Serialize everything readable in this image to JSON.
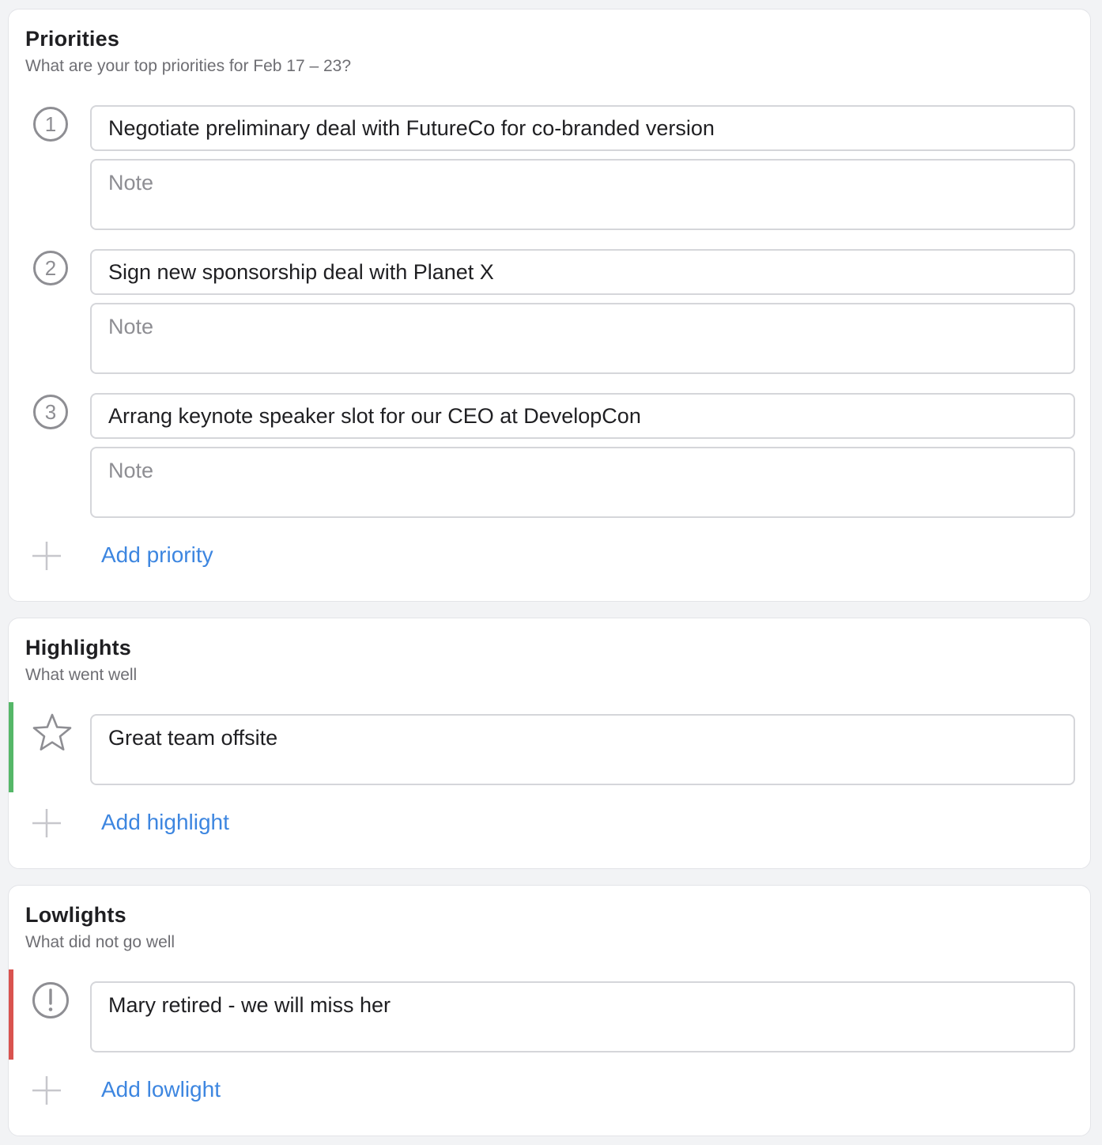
{
  "colors": {
    "background": "#f2f3f5",
    "card": "#ffffff",
    "border": "#d5d6da",
    "link": "#3d86e0",
    "highlight_accent": "#55b768",
    "lowlight_accent": "#d9534f",
    "icon": "#8e8e93"
  },
  "priorities": {
    "title": "Priorities",
    "subtitle": "What are your top priorities for Feb 17 – 23?",
    "items": [
      {
        "number": "1",
        "text": "Negotiate preliminary deal with FutureCo for co-branded version",
        "note_placeholder": "Note",
        "icon": "circled-number-icon"
      },
      {
        "number": "2",
        "text": "Sign new sponsorship deal with Planet X",
        "note_placeholder": "Note",
        "icon": "circled-number-icon"
      },
      {
        "number": "3",
        "text": "Arrang keynote speaker slot for our CEO at DevelopCon",
        "note_placeholder": "Note",
        "icon": "circled-number-icon"
      }
    ],
    "add_label": "Add priority"
  },
  "highlights": {
    "title": "Highlights",
    "subtitle": "What went well",
    "items": [
      {
        "text": "Great team offsite",
        "icon": "star-icon"
      }
    ],
    "add_label": "Add highlight"
  },
  "lowlights": {
    "title": "Lowlights",
    "subtitle": "What did not go well",
    "items": [
      {
        "text": "Mary retired - we will miss her",
        "icon": "exclamation-circle-icon"
      }
    ],
    "add_label": "Add lowlight"
  }
}
